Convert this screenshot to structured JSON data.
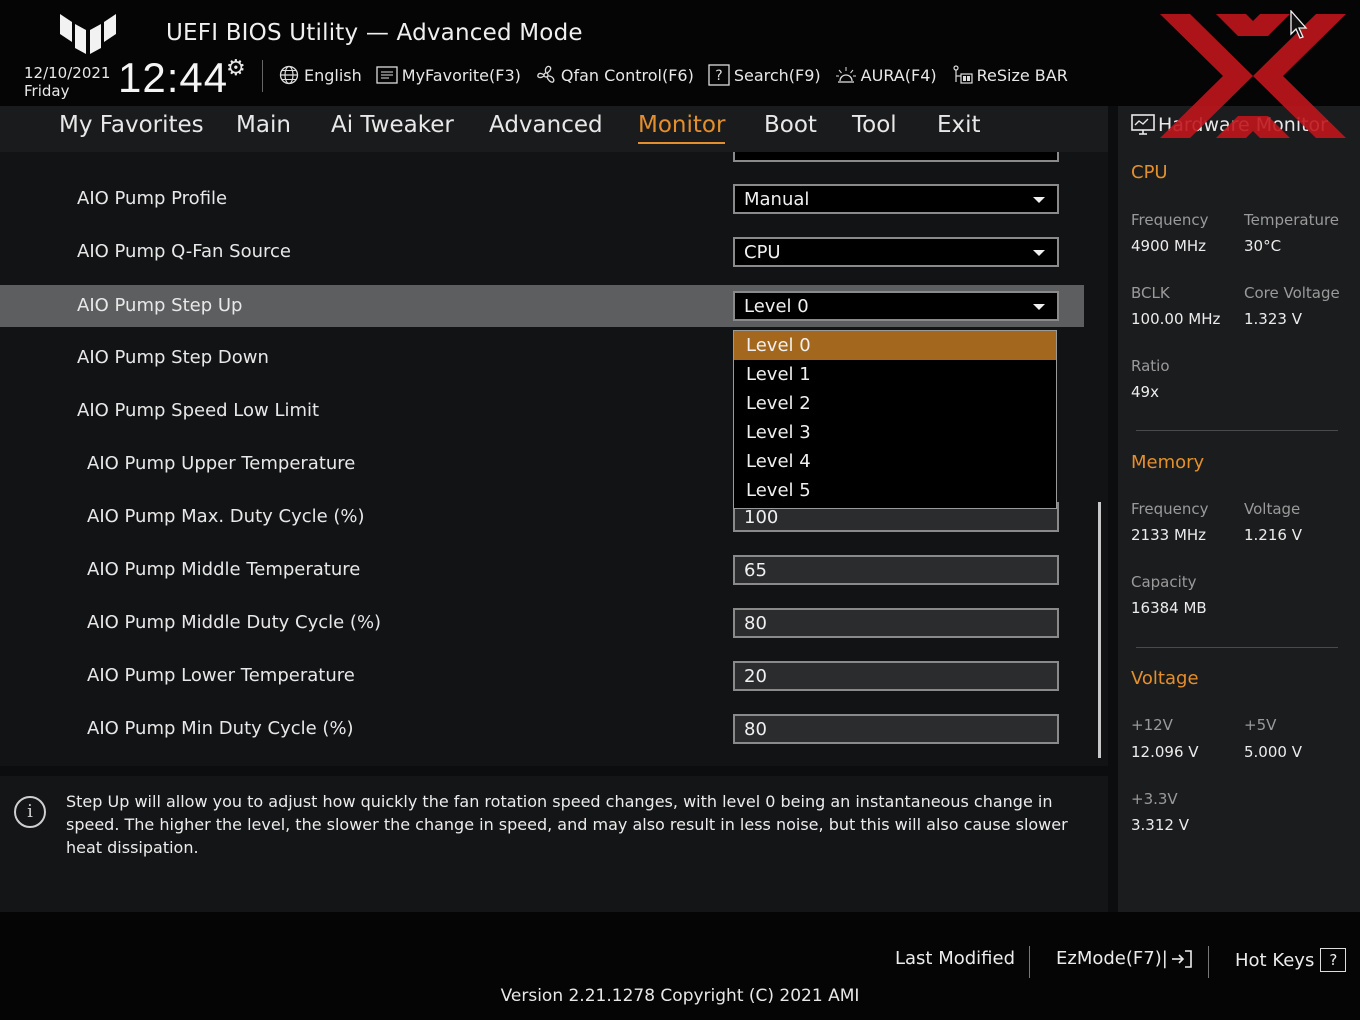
{
  "header": {
    "title": "UEFI BIOS Utility — Advanced Mode",
    "date": "12/10/2021",
    "day": "Friday",
    "time": "12:44",
    "toolbar": [
      {
        "label": "English",
        "icon": "globe-icon"
      },
      {
        "label": "MyFavorite(F3)",
        "icon": "favorite-list-icon"
      },
      {
        "label": "Qfan Control(F6)",
        "icon": "fan-icon"
      },
      {
        "label": "Search(F9)",
        "icon": "help-search-icon"
      },
      {
        "label": "AURA(F4)",
        "icon": "aura-light-icon"
      },
      {
        "label": "ReSize BAR",
        "icon": "resize-bar-icon"
      }
    ]
  },
  "tabs": [
    "My Favorites",
    "Main",
    "Ai Tweaker",
    "Advanced",
    "Monitor",
    "Boot",
    "Tool",
    "Exit"
  ],
  "active_tab": "Monitor",
  "settings": [
    {
      "label": "AIO Pump Profile",
      "value": "Manual",
      "type": "select"
    },
    {
      "label": "AIO Pump Q-Fan Source",
      "value": "CPU",
      "type": "select"
    },
    {
      "label": "AIO Pump Step Up",
      "value": "Level 0",
      "type": "select",
      "selected": true
    },
    {
      "label": "AIO Pump Step Down",
      "value": "",
      "type": "select"
    },
    {
      "label": "AIO Pump Speed Low Limit",
      "value": "",
      "type": "select"
    },
    {
      "label": "AIO Pump Upper Temperature",
      "value": "",
      "type": "text"
    },
    {
      "label": "AIO Pump Max. Duty Cycle (%)",
      "value": "100",
      "type": "text"
    },
    {
      "label": "AIO Pump Middle Temperature",
      "value": "65",
      "type": "text"
    },
    {
      "label": "AIO Pump Middle Duty Cycle (%)",
      "value": "80",
      "type": "text"
    },
    {
      "label": "AIO Pump Lower Temperature",
      "value": "20",
      "type": "text"
    },
    {
      "label": "AIO Pump Min Duty Cycle (%)",
      "value": "80",
      "type": "text"
    }
  ],
  "dropdown": {
    "options": [
      "Level 0",
      "Level 1",
      "Level 2",
      "Level 3",
      "Level 4",
      "Level 5"
    ],
    "highlighted": "Level 0"
  },
  "help_text": "Step Up will allow you to adjust how quickly the fan rotation speed changes, with level 0 being an instantaneous change in speed. The higher the level, the slower the change in speed, and may also result in less noise, but this will also cause slower heat dissipation.",
  "hardware_monitor": {
    "title": "Hardware Monitor",
    "cpu": {
      "title": "CPU",
      "frequency_label": "Frequency",
      "frequency": "4900 MHz",
      "temperature_label": "Temperature",
      "temperature": "30°C",
      "bclk_label": "BCLK",
      "bclk": "100.00 MHz",
      "core_voltage_label": "Core Voltage",
      "core_voltage": "1.323 V",
      "ratio_label": "Ratio",
      "ratio": "49x"
    },
    "memory": {
      "title": "Memory",
      "frequency_label": "Frequency",
      "frequency": "2133 MHz",
      "voltage_label": "Voltage",
      "voltage": "1.216 V",
      "capacity_label": "Capacity",
      "capacity": "16384 MB"
    },
    "voltage": {
      "title": "Voltage",
      "v12_label": "+12V",
      "v12": "12.096 V",
      "v5_label": "+5V",
      "v5": "5.000 V",
      "v33_label": "+3.3V",
      "v33": "3.312 V"
    }
  },
  "footer": {
    "last_modified": "Last Modified",
    "ezmode": "EzMode(F7)|",
    "hotkeys": "Hot Keys",
    "hotkeys_symbol": "?",
    "version": "Version 2.21.1278 Copyright (C) 2021 AMI"
  },
  "colors": {
    "accent": "#e48f2d",
    "highlight": "#a4671e",
    "watermark": "#c0161c"
  }
}
